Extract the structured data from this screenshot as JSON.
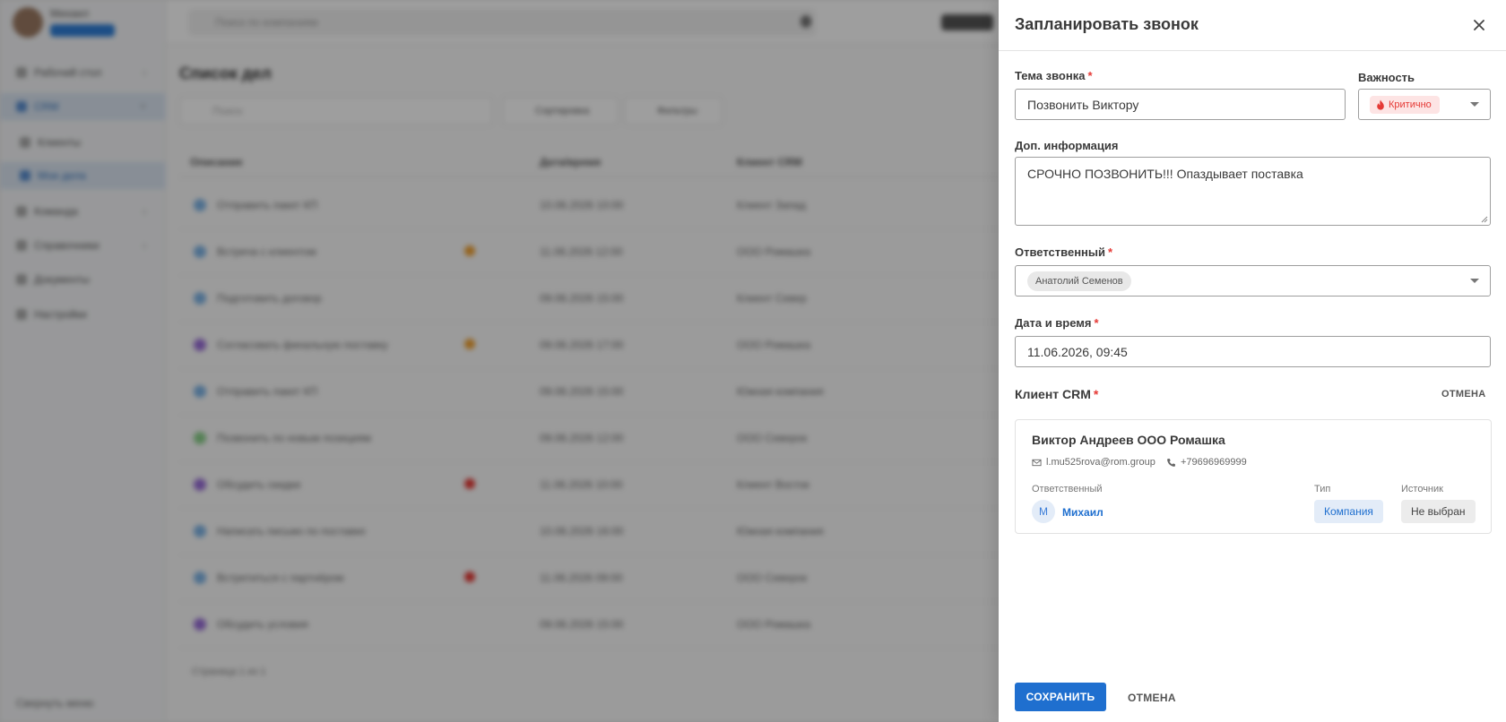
{
  "background": {
    "user_name": "Михаил",
    "search_placeholder": "Поиск по компаниям",
    "nav": [
      {
        "label": "Рабочий стол"
      },
      {
        "label": "CRM"
      },
      {
        "label": "Клиенты"
      },
      {
        "label": "Мои дела"
      },
      {
        "label": "Команда"
      },
      {
        "label": "Справочники"
      },
      {
        "label": "Документы"
      },
      {
        "label": "Настройки"
      }
    ],
    "page_title": "Список дел",
    "filter_placeholder": "Поиск",
    "btn_sort": "Сортировка",
    "btn_filters": "Фильтры",
    "columns": [
      "Описание",
      "Дата/время",
      "Клиент CRM"
    ],
    "rows": [
      {
        "title": "Отправить пакет КП",
        "date": "10.06.2026 10:00",
        "client": "Клиент Запад"
      },
      {
        "title": "Встреча с клиентом",
        "date": "11.06.2026 12:00",
        "client": "ООО Ромашка"
      },
      {
        "title": "Подготовить договор",
        "date": "09.06.2026 15:00",
        "client": "Клиент Север"
      },
      {
        "title": "Согласовать финальную поставку",
        "date": "09.06.2026 17:00",
        "client": "ООО Ромашка"
      },
      {
        "title": "Отправить пакет КП",
        "date": "09.06.2026 15:00",
        "client": "Южная компания"
      },
      {
        "title": "Позвонить по новым позициям",
        "date": "09.06.2026 12:00",
        "client": "ООО Северок"
      },
      {
        "title": "Обсудить скидки",
        "date": "11.06.2026 10:00",
        "client": "Клиент Восток"
      },
      {
        "title": "Написать письмо по поставке",
        "date": "10.06.2026 16:00",
        "client": "Южная компания"
      },
      {
        "title": "Встретиться с партнёром",
        "date": "11.06.2026 09:00",
        "client": "ООО Северок"
      },
      {
        "title": "Обсудить условия",
        "date": "09.06.2026 15:00",
        "client": "ООО Ромашка"
      }
    ],
    "footer_text": "Страница 1 из 1",
    "sidebar_bottom": "Свернуть меню"
  },
  "drawer": {
    "title": "Запланировать звонок",
    "topic_label": "Тема звонка",
    "topic_value": "Позвонить Виктору",
    "importance_label": "Важность",
    "importance_value": "Критично",
    "info_label": "Доп. информация",
    "info_value": "СРОЧНО ПОЗВОНИТЬ!!! Опаздывает поставка",
    "responsible_label": "Ответственный",
    "responsible_value": "Анатолий Семенов",
    "datetime_label": "Дата и время",
    "datetime_value": "11.06.2026, 09:45",
    "client_label": "Клиент CRM",
    "client_cancel": "ОТМЕНА",
    "client": {
      "name": "Виктор Андреев ООО Ромашка",
      "email": "l.mu525rova@rom.group",
      "phone": "+79696969999",
      "responsible_label": "Ответственный",
      "responsible_initial": "М",
      "responsible_name": "Михаил",
      "type_label": "Тип",
      "type_value": "Компания",
      "source_label": "Источник",
      "source_value": "Не выбран"
    },
    "save_label": "СОХРАНИТЬ",
    "cancel_label": "ОТМЕНА"
  },
  "colors": {
    "primary": "#1f6fcf",
    "required": "#e53935",
    "critical_bg": "#fde4e4",
    "overlay": "rgba(0,0,0,0.38)"
  }
}
